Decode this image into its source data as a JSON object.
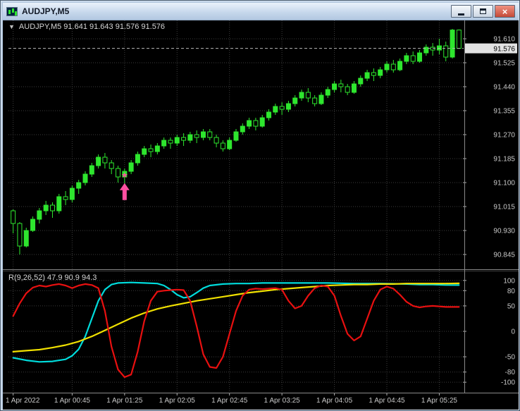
{
  "window": {
    "title": "AUDJPY,M5",
    "close_glyph": "×"
  },
  "header": {
    "dropdown_arrow": "▼",
    "text": "AUDJPY,M5 91.641 91.643 91.576 91.576"
  },
  "indicator_header": "R(9,26,52) 47.9 90.9 94.3",
  "colors": {
    "background": "#000000",
    "grid": "#3c3c3c",
    "candle_up": "#2ee62e",
    "candle_down_fill": "#000000",
    "axis_text": "#c8c8c8",
    "price_box_bg": "#e2e2e2",
    "indicator_fast": "#e81010",
    "indicator_middle": "#00dcdc",
    "indicator_slow": "#f0e000",
    "marker": "#ff4fa0"
  },
  "chart_data": {
    "type": "candlestick",
    "symbol": "AUDJPY",
    "period": "M5",
    "ohlc_header": {
      "open": 91.641,
      "high": 91.643,
      "low": 91.576,
      "close": 91.576
    },
    "current_price": "91.576",
    "price_ticks": [
      "91.610",
      "91.525",
      "91.440",
      "91.355",
      "91.270",
      "91.185",
      "91.100",
      "91.015",
      "90.930",
      "90.845"
    ],
    "x_labels": [
      "1 Apr 2022",
      "1 Apr 00:45",
      "1 Apr 01:25",
      "1 Apr 02:05",
      "1 Apr 02:45",
      "1 Apr 03:25",
      "1 Apr 04:05",
      "1 Apr 04:45",
      "1 Apr 05:25"
    ],
    "x_label_indices": [
      0,
      9,
      17,
      25,
      33,
      41,
      49,
      57,
      65
    ],
    "candles_ohlc": [
      [
        91.0,
        91.005,
        90.92,
        90.955
      ],
      [
        90.955,
        90.96,
        90.845,
        90.875
      ],
      [
        90.875,
        90.94,
        90.87,
        90.93
      ],
      [
        90.93,
        90.98,
        90.925,
        90.97
      ],
      [
        90.97,
        91.01,
        90.955,
        91.0
      ],
      [
        91.0,
        91.035,
        90.985,
        91.02
      ],
      [
        91.02,
        91.03,
        90.975,
        91.0
      ],
      [
        91.0,
        91.06,
        90.99,
        91.05
      ],
      [
        91.05,
        91.07,
        91.02,
        91.04
      ],
      [
        91.04,
        91.09,
        91.03,
        91.08
      ],
      [
        91.08,
        91.11,
        91.06,
        91.1
      ],
      [
        91.1,
        91.14,
        91.09,
        91.13
      ],
      [
        91.13,
        91.17,
        91.12,
        91.16
      ],
      [
        91.16,
        91.2,
        91.15,
        91.19
      ],
      [
        91.19,
        91.205,
        91.15,
        91.17
      ],
      [
        91.17,
        91.18,
        91.13,
        91.15
      ],
      [
        91.15,
        91.16,
        91.1,
        91.12
      ],
      [
        91.12,
        91.15,
        91.095,
        91.14
      ],
      [
        91.14,
        91.18,
        91.13,
        91.17
      ],
      [
        91.17,
        91.21,
        91.16,
        91.2
      ],
      [
        91.2,
        91.23,
        91.19,
        91.22
      ],
      [
        91.22,
        91.235,
        91.19,
        91.21
      ],
      [
        91.21,
        91.24,
        91.2,
        91.23
      ],
      [
        91.23,
        91.26,
        91.22,
        91.25
      ],
      [
        91.25,
        91.26,
        91.22,
        91.24
      ],
      [
        91.24,
        91.27,
        91.23,
        91.26
      ],
      [
        91.26,
        91.275,
        91.23,
        91.25
      ],
      [
        91.25,
        91.28,
        91.24,
        91.27
      ],
      [
        91.27,
        91.285,
        91.24,
        91.26
      ],
      [
        91.26,
        91.29,
        91.25,
        91.28
      ],
      [
        91.28,
        91.29,
        91.25,
        91.26
      ],
      [
        91.26,
        91.27,
        91.225,
        91.24
      ],
      [
        91.24,
        91.25,
        91.21,
        91.22
      ],
      [
        91.22,
        91.26,
        91.215,
        91.25
      ],
      [
        91.25,
        91.29,
        91.245,
        91.28
      ],
      [
        91.28,
        91.31,
        91.27,
        91.3
      ],
      [
        91.3,
        91.33,
        91.29,
        91.32
      ],
      [
        91.32,
        91.33,
        91.285,
        91.3
      ],
      [
        91.3,
        91.34,
        91.295,
        91.33
      ],
      [
        91.33,
        91.36,
        91.32,
        91.35
      ],
      [
        91.35,
        91.38,
        91.34,
        91.37
      ],
      [
        91.37,
        91.385,
        91.34,
        91.36
      ],
      [
        91.36,
        91.39,
        91.35,
        91.38
      ],
      [
        91.38,
        91.41,
        91.37,
        91.4
      ],
      [
        91.4,
        91.43,
        91.39,
        91.42
      ],
      [
        91.42,
        91.435,
        91.385,
        91.4
      ],
      [
        91.4,
        91.41,
        91.37,
        91.38
      ],
      [
        91.38,
        91.42,
        91.375,
        91.41
      ],
      [
        91.41,
        91.44,
        91.4,
        91.43
      ],
      [
        91.43,
        91.46,
        91.42,
        91.45
      ],
      [
        91.45,
        91.465,
        91.42,
        91.44
      ],
      [
        91.44,
        91.45,
        91.41,
        91.42
      ],
      [
        91.42,
        91.46,
        91.415,
        91.45
      ],
      [
        91.45,
        91.48,
        91.44,
        91.47
      ],
      [
        91.47,
        91.5,
        91.46,
        91.49
      ],
      [
        91.49,
        91.505,
        91.46,
        91.48
      ],
      [
        91.48,
        91.51,
        91.47,
        91.5
      ],
      [
        91.5,
        91.53,
        91.49,
        91.52
      ],
      [
        91.52,
        91.535,
        91.49,
        91.5
      ],
      [
        91.5,
        91.54,
        91.495,
        91.53
      ],
      [
        91.53,
        91.56,
        91.52,
        91.55
      ],
      [
        91.55,
        91.565,
        91.52,
        91.53
      ],
      [
        91.53,
        91.57,
        91.525,
        91.56
      ],
      [
        91.56,
        91.59,
        91.55,
        91.58
      ],
      [
        91.58,
        91.595,
        91.55,
        91.57
      ],
      [
        91.57,
        91.61,
        91.555,
        91.585
      ],
      [
        91.585,
        91.6,
        91.53,
        91.545
      ],
      [
        91.545,
        91.645,
        91.54,
        91.641
      ],
      [
        91.641,
        91.643,
        91.576,
        91.576
      ]
    ],
    "indicator": {
      "name": "R(9,26,52)",
      "current_values": [
        47.9,
        90.9,
        94.3
      ],
      "scale_ticks": [
        100,
        80,
        50,
        0,
        -50,
        -80,
        -100
      ],
      "series": [
        {
          "name": "middle",
          "color": "#00dcdc",
          "points": [
            [
              0,
              -52
            ],
            [
              2,
              -57
            ],
            [
              4,
              -60
            ],
            [
              6,
              -59
            ],
            [
              8,
              -55
            ],
            [
              9,
              -48
            ],
            [
              10,
              -35
            ],
            [
              11,
              -10
            ],
            [
              12,
              25
            ],
            [
              13,
              60
            ],
            [
              14,
              82
            ],
            [
              15,
              92
            ],
            [
              16,
              95
            ],
            [
              18,
              96
            ],
            [
              20,
              95
            ],
            [
              22,
              94
            ],
            [
              23,
              90
            ],
            [
              24,
              82
            ],
            [
              25,
              72
            ],
            [
              26,
              66
            ],
            [
              27,
              68
            ],
            [
              28,
              76
            ],
            [
              29,
              85
            ],
            [
              30,
              90
            ],
            [
              32,
              93
            ],
            [
              34,
              94
            ],
            [
              36,
              94
            ],
            [
              38,
              95
            ],
            [
              40,
              95
            ],
            [
              44,
              95
            ],
            [
              48,
              95
            ],
            [
              52,
              94
            ],
            [
              56,
              94
            ],
            [
              60,
              93
            ],
            [
              62,
              92
            ],
            [
              64,
              92
            ],
            [
              66,
              91
            ],
            [
              68,
              90.9
            ]
          ]
        },
        {
          "name": "slow",
          "color": "#f0e000",
          "points": [
            [
              0,
              -40
            ],
            [
              2,
              -38
            ],
            [
              4,
              -36
            ],
            [
              6,
              -32
            ],
            [
              8,
              -27
            ],
            [
              10,
              -20
            ],
            [
              12,
              -10
            ],
            [
              14,
              2
            ],
            [
              16,
              14
            ],
            [
              18,
              26
            ],
            [
              20,
              36
            ],
            [
              22,
              44
            ],
            [
              24,
              50
            ],
            [
              26,
              55
            ],
            [
              28,
              60
            ],
            [
              30,
              64
            ],
            [
              32,
              68
            ],
            [
              34,
              72
            ],
            [
              36,
              76
            ],
            [
              38,
              79
            ],
            [
              40,
              82
            ],
            [
              42,
              84
            ],
            [
              44,
              86
            ],
            [
              46,
              88
            ],
            [
              48,
              90
            ],
            [
              50,
              91
            ],
            [
              52,
              92
            ],
            [
              54,
              92
            ],
            [
              56,
              93
            ],
            [
              58,
              93
            ],
            [
              60,
              94
            ],
            [
              62,
              94
            ],
            [
              64,
              94
            ],
            [
              66,
              94
            ],
            [
              68,
              94.3
            ]
          ]
        },
        {
          "name": "fast",
          "color": "#e81010",
          "points": [
            [
              0,
              30
            ],
            [
              1,
              55
            ],
            [
              2,
              75
            ],
            [
              3,
              86
            ],
            [
              4,
              90
            ],
            [
              5,
              88
            ],
            [
              6,
              91
            ],
            [
              7,
              93
            ],
            [
              8,
              90
            ],
            [
              9,
              85
            ],
            [
              10,
              90
            ],
            [
              11,
              93
            ],
            [
              12,
              91
            ],
            [
              13,
              85
            ],
            [
              14,
              40
            ],
            [
              15,
              -30
            ],
            [
              16,
              -75
            ],
            [
              17,
              -90
            ],
            [
              18,
              -85
            ],
            [
              19,
              -40
            ],
            [
              20,
              20
            ],
            [
              21,
              60
            ],
            [
              22,
              78
            ],
            [
              23,
              80
            ],
            [
              24,
              81
            ],
            [
              25,
              82
            ],
            [
              26,
              81
            ],
            [
              27,
              60
            ],
            [
              28,
              10
            ],
            [
              29,
              -45
            ],
            [
              30,
              -70
            ],
            [
              31,
              -72
            ],
            [
              32,
              -50
            ],
            [
              33,
              -5
            ],
            [
              34,
              40
            ],
            [
              35,
              70
            ],
            [
              36,
              82
            ],
            [
              37,
              84
            ],
            [
              38,
              83
            ],
            [
              39,
              84
            ],
            [
              40,
              85
            ],
            [
              41,
              82
            ],
            [
              42,
              60
            ],
            [
              43,
              45
            ],
            [
              44,
              50
            ],
            [
              45,
              70
            ],
            [
              46,
              85
            ],
            [
              47,
              90
            ],
            [
              48,
              88
            ],
            [
              49,
              70
            ],
            [
              50,
              30
            ],
            [
              51,
              -5
            ],
            [
              52,
              -18
            ],
            [
              53,
              -10
            ],
            [
              54,
              25
            ],
            [
              55,
              60
            ],
            [
              56,
              82
            ],
            [
              57,
              88
            ],
            [
              58,
              84
            ],
            [
              59,
              72
            ],
            [
              60,
              58
            ],
            [
              61,
              50
            ],
            [
              62,
              47
            ],
            [
              63,
              49
            ],
            [
              64,
              50
            ],
            [
              65,
              49
            ],
            [
              66,
              48
            ],
            [
              67,
              48
            ],
            [
              68,
              47.9
            ]
          ]
        }
      ]
    },
    "marker": {
      "type": "buy-signal",
      "candle_index": 17,
      "star_glyph": "★",
      "star_price": 91.128,
      "arrow_price": 91.098,
      "color": "#ff4fa0"
    }
  }
}
